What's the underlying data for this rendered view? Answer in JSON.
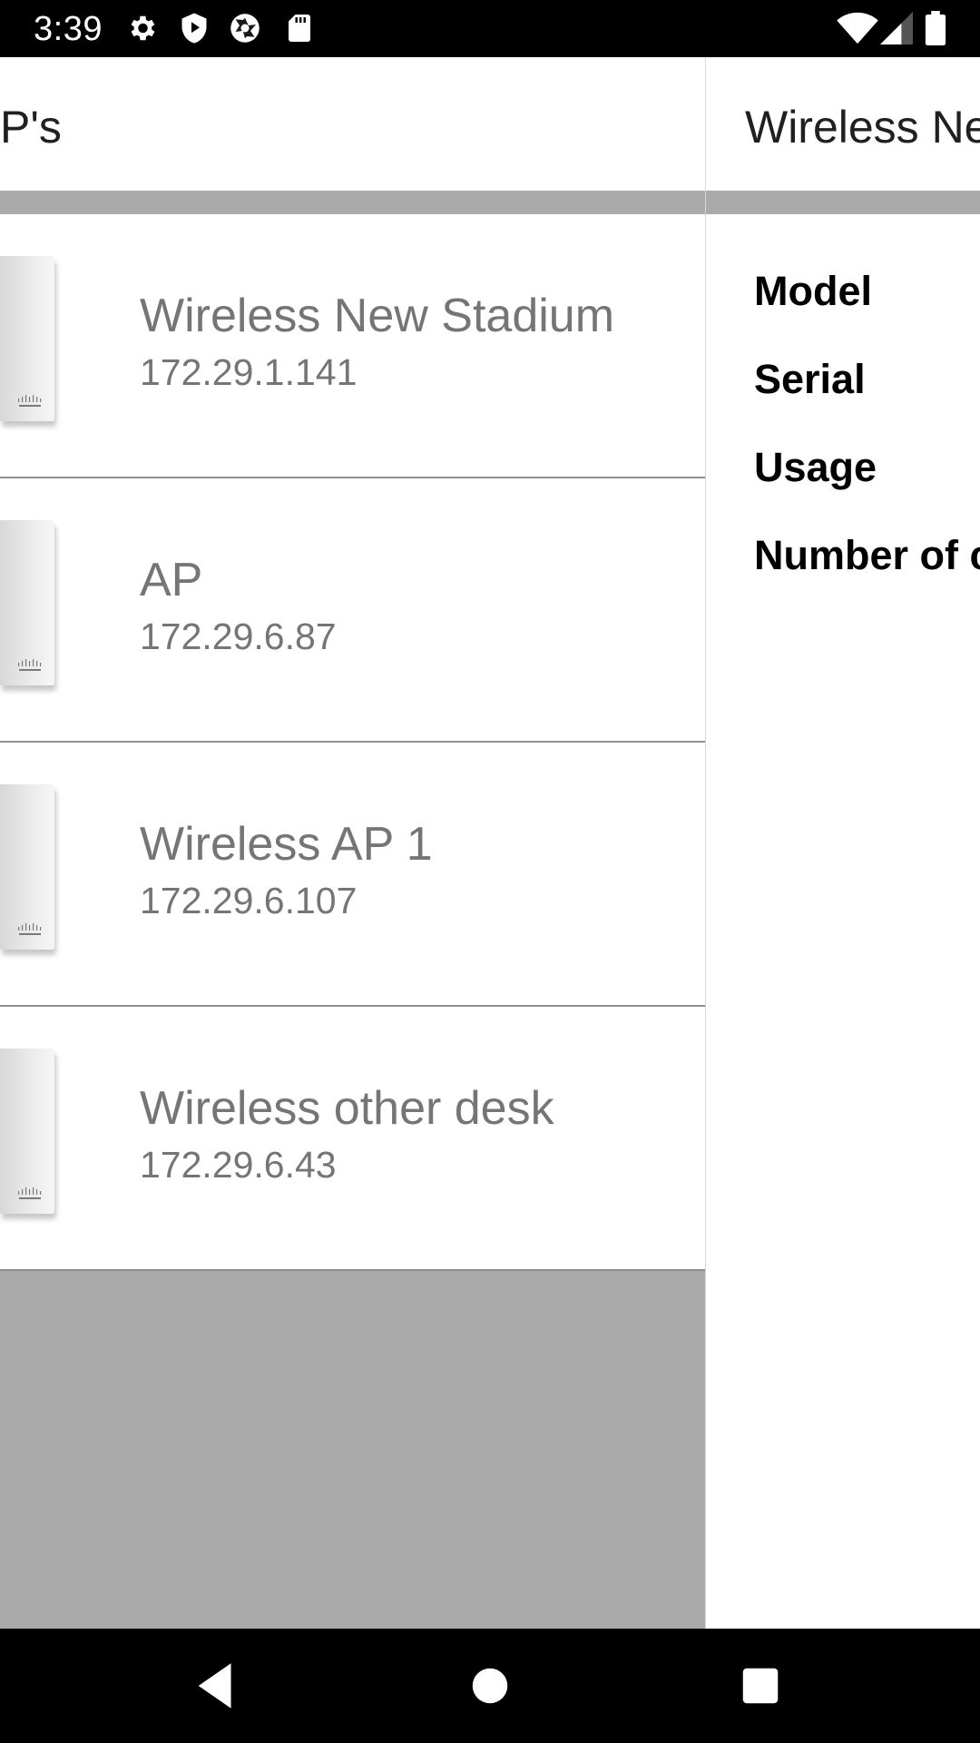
{
  "status_bar": {
    "time": "3:39",
    "icons": [
      "settings-icon",
      "shield-play-icon",
      "camera-shutter-icon",
      "sd-card-icon",
      "wifi-icon",
      "signal-icon",
      "battery-icon"
    ]
  },
  "left_panel": {
    "title": "P's",
    "items": [
      {
        "name": "Wireless New Stadium",
        "ip": "172.29.1.141"
      },
      {
        "name": "AP",
        "ip": "172.29.6.87"
      },
      {
        "name": "Wireless AP 1",
        "ip": "172.29.6.107"
      },
      {
        "name": "Wireless other desk",
        "ip": "172.29.6.43"
      }
    ]
  },
  "right_panel": {
    "title": "Wireless Ne",
    "properties": [
      "Model",
      "Serial",
      "Usage",
      "Number of c"
    ]
  },
  "nav_bar": {
    "buttons": [
      "back-icon",
      "home-icon",
      "recents-icon"
    ]
  },
  "colors": {
    "panel_gray": "#aaaaaa",
    "item_text": "#757575",
    "divider": "#8f8f8f"
  }
}
